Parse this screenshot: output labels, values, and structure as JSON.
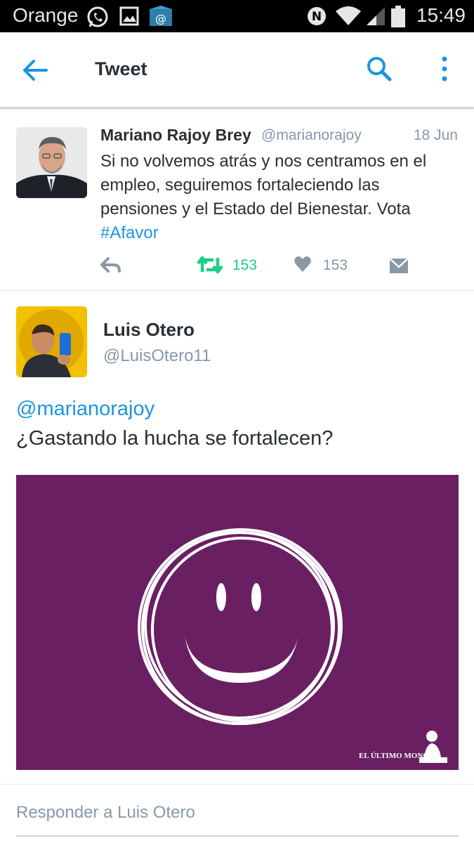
{
  "status_bar": {
    "carrier": "Orange",
    "time": "15:49",
    "icons": [
      "whatsapp-icon",
      "gallery-icon",
      "email-icon",
      "nfc-icon",
      "wifi-icon",
      "signal-icon",
      "battery-icon"
    ]
  },
  "app_bar": {
    "title": "Tweet",
    "back_icon": "arrow-left-icon",
    "search_icon": "search-icon",
    "more_icon": "more-vertical-icon",
    "accent_color": "#1b95e0"
  },
  "parent_tweet": {
    "name": "Mariano Rajoy Brey",
    "handle": "@marianorajoy",
    "date": "18 Jun",
    "text": "Si no volvemos atrás y nos centramos en el empleo, seguiremos fortaleciendo las pensiones y el Estado del Bienestar. Vota ",
    "hashtag": "#Afavor",
    "retweet_count": "153",
    "like_count": "153",
    "retweet_color": "#19cf86"
  },
  "tweet": {
    "name": "Luis Otero",
    "handle": "@LuisOtero11",
    "mention": "@marianorajoy",
    "text": "¿Gastando la hucha se fortalecen?",
    "image": {
      "background": "#6a1f62",
      "watermark": "EL ÚLTIMO MONO"
    }
  },
  "reply": {
    "placeholder": "Responder a Luis Otero"
  }
}
